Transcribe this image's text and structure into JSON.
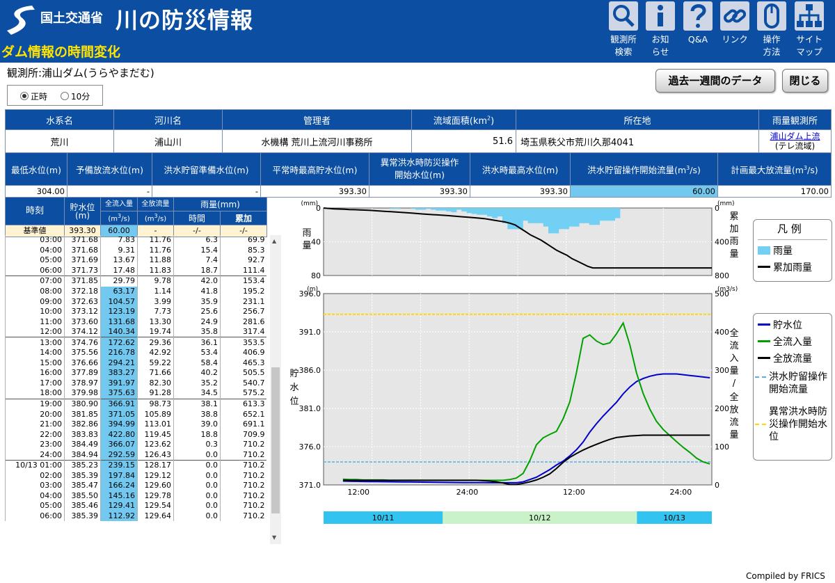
{
  "header": {
    "ministry": "国土交通省",
    "site_title": "川の防災情報",
    "page_heading": "ダム情報の時間変化",
    "nav": [
      {
        "label1": "観測所",
        "label2": "検索",
        "icon": "search-icon"
      },
      {
        "label1": "お知",
        "label2": "らせ",
        "icon": "info-icon"
      },
      {
        "label1": "Q&A",
        "label2": "",
        "icon": "question-icon"
      },
      {
        "label1": "リンク",
        "label2": "",
        "icon": "link-icon"
      },
      {
        "label1": "操作",
        "label2": "方法",
        "icon": "mouse-icon"
      },
      {
        "label1": "サイト",
        "label2": "マップ",
        "icon": "sitemap-icon"
      }
    ]
  },
  "station": {
    "label": "観測所:浦山ダム(うらやまだむ)"
  },
  "buttons": {
    "week": "過去一週間のデータ",
    "close": "閉じる"
  },
  "interval": {
    "options": [
      "正時",
      "10分"
    ],
    "selected": "正時"
  },
  "info1": {
    "headers": [
      "水系名",
      "河川名",
      "管理者",
      "流域面積(km",
      "2",
      ")",
      "所在地",
      "雨量観測所"
    ],
    "values": [
      "荒川",
      "浦山川",
      "水機構 荒川上流河川事務所",
      "51.6",
      "埼玉県秩父市荒川久那4041",
      "浦山ダム上流",
      "(テレ流域)"
    ]
  },
  "info2": {
    "headers": [
      "最低水位(m)",
      "予備放流水位(m)",
      "洪水貯留準備水位(m)",
      "平常時最高貯水位(m)",
      "異常洪水時防災操作",
      "開始水位(m)",
      "洪水時最高水位(m)",
      "洪水貯留操作開始流量(m",
      "3",
      "/s)",
      "計画最大放流量(m",
      "3",
      "/s)"
    ],
    "values": [
      "304.00",
      "-",
      "-",
      "393.30",
      "393.30",
      "393.30",
      "60.00",
      "170.00"
    ]
  },
  "data_table": {
    "headers": {
      "time": "時刻",
      "level": "貯水位",
      "level_unit": "(m)",
      "inflow": "全流入量",
      "inflow_unit": "(m",
      "outflow": "全放流量",
      "outflow_unit": "(m",
      "rain": "雨量(mm)",
      "hourly": "時間",
      "cumulative": "累加",
      "unit_sup": "3",
      "unit_tail": "/s)"
    },
    "base": {
      "label": "基準値",
      "level": "393.30",
      "inflow": "60.00",
      "outflow": "-",
      "hourly": "-/-",
      "cumulative": "-/-"
    },
    "rows": [
      [
        "03:00",
        "371.68",
        "7.83",
        "11.76",
        "6.3",
        "69.9"
      ],
      [
        "04:00",
        "371.68",
        "9.31",
        "11.76",
        "15.4",
        "85.3"
      ],
      [
        "05:00",
        "371.69",
        "13.67",
        "11.88",
        "7.4",
        "92.7"
      ],
      [
        "06:00",
        "371.73",
        "17.48",
        "11.83",
        "18.7",
        "111.4"
      ],
      [
        "07:00",
        "371.85",
        "29.79",
        "9.78",
        "42.0",
        "153.4"
      ],
      [
        "08:00",
        "372.18",
        "63.17",
        "1.14",
        "41.8",
        "195.2"
      ],
      [
        "09:00",
        "372.63",
        "104.57",
        "3.99",
        "35.9",
        "231.1"
      ],
      [
        "10:00",
        "373.12",
        "123.19",
        "7.73",
        "25.6",
        "256.7"
      ],
      [
        "11:00",
        "373.60",
        "131.68",
        "13.30",
        "24.9",
        "281.6"
      ],
      [
        "12:00",
        "374.12",
        "140.34",
        "19.74",
        "35.8",
        "317.4"
      ],
      [
        "13:00",
        "374.76",
        "172.62",
        "29.36",
        "36.1",
        "353.5"
      ],
      [
        "14:00",
        "375.56",
        "216.78",
        "42.92",
        "53.4",
        "406.9"
      ],
      [
        "15:00",
        "376.66",
        "294.21",
        "59.22",
        "58.4",
        "465.3"
      ],
      [
        "16:00",
        "377.89",
        "383.27",
        "71.66",
        "40.2",
        "505.5"
      ],
      [
        "17:00",
        "378.97",
        "391.97",
        "82.30",
        "35.2",
        "540.7"
      ],
      [
        "18:00",
        "379.98",
        "375.63",
        "91.28",
        "34.5",
        "575.2"
      ],
      [
        "19:00",
        "380.90",
        "366.91",
        "98.73",
        "38.1",
        "613.3"
      ],
      [
        "20:00",
        "381.85",
        "371.05",
        "105.89",
        "38.8",
        "652.1"
      ],
      [
        "21:00",
        "382.86",
        "394.99",
        "113.01",
        "39.0",
        "691.1"
      ],
      [
        "22:00",
        "383.83",
        "422.80",
        "119.45",
        "18.8",
        "709.9"
      ],
      [
        "23:00",
        "384.49",
        "366.07",
        "123.62",
        "0.3",
        "710.2"
      ],
      [
        "24:00",
        "384.94",
        "292.59",
        "126.43",
        "0.0",
        "710.2"
      ],
      [
        "10/13 01:00",
        "385.23",
        "239.15",
        "128.17",
        "0.0",
        "710.2"
      ],
      [
        "02:00",
        "385.39",
        "197.84",
        "129.12",
        "0.0",
        "710.2"
      ],
      [
        "03:00",
        "385.47",
        "166.24",
        "129.60",
        "0.0",
        "710.2"
      ],
      [
        "04:00",
        "385.50",
        "145.16",
        "129.78",
        "0.0",
        "710.2"
      ],
      [
        "05:00",
        "385.46",
        "129.41",
        "129.54",
        "0.0",
        "710.2"
      ],
      [
        "06:00",
        "385.39",
        "112.92",
        "129.64",
        "0.0",
        "710.2"
      ]
    ]
  },
  "chart_data": [
    {
      "type": "area",
      "ylabel": "雨量",
      "y2label": "累加雨量",
      "yunit": "(mm)",
      "y2unit": "(mm)",
      "ylim": [
        80,
        0
      ],
      "y2lim": [
        800,
        0
      ],
      "yticks": [
        "0",
        "40",
        "80"
      ],
      "y2ticks": [
        "0",
        "400",
        "800"
      ],
      "series": [
        {
          "name": "雨量"
        },
        {
          "name": "累加雨量"
        }
      ],
      "hourly_rain": [
        0,
        0,
        0,
        0,
        0,
        0,
        0,
        0,
        0,
        0,
        0,
        0,
        0,
        1,
        1,
        0,
        0,
        1,
        2,
        2,
        1,
        2,
        3,
        3,
        4,
        5,
        2,
        4,
        6,
        7,
        8,
        8,
        10,
        12,
        10,
        18,
        25,
        25,
        25,
        15,
        18,
        18,
        18,
        22,
        30,
        30,
        25,
        25,
        22,
        22,
        18,
        18,
        20,
        20,
        15,
        15,
        15,
        12,
        0,
        0,
        0,
        0,
        0,
        0,
        0,
        0,
        0,
        0,
        0,
        0,
        0,
        0,
        0,
        0,
        0,
        0
      ],
      "cumulative_rain": [
        0,
        5,
        10,
        12,
        15,
        18,
        20,
        22,
        25,
        28,
        32,
        36,
        40,
        44,
        48,
        52,
        56,
        60,
        65,
        70,
        74,
        78,
        82,
        86,
        90,
        95,
        100,
        105,
        110,
        115,
        120,
        125,
        135,
        145,
        155,
        165,
        180,
        200,
        240,
        280,
        320,
        350,
        380,
        420,
        460,
        500,
        530,
        560,
        600,
        630,
        660,
        690,
        710,
        710,
        710,
        710,
        710,
        710,
        710,
        710,
        710,
        710,
        710,
        710,
        710,
        710,
        710,
        710,
        710,
        710,
        710,
        710,
        710,
        710,
        710,
        710
      ]
    },
    {
      "type": "line",
      "ylabel": "貯水位",
      "y2label": "全流入量/全放流量",
      "yunit": "(m)",
      "y2unit": "(m3/s)",
      "ylim": [
        371.0,
        396.0
      ],
      "y2lim": [
        0,
        500
      ],
      "yticks": [
        "371.0",
        "376.0",
        "381.0",
        "386.0",
        "391.0",
        "396.0"
      ],
      "y2ticks": [
        "0",
        "100",
        "200",
        "300",
        "400",
        "500"
      ],
      "x_ticks": [
        "12:00",
        "24:00",
        "12:00",
        "24:00"
      ],
      "date_bands": [
        "10/11",
        "10/12",
        "10/13"
      ],
      "series": [
        {
          "name": "貯水位",
          "color": "#0000cc"
        },
        {
          "name": "全流入量",
          "color": "#00a000"
        },
        {
          "name": "全放流量",
          "color": "#000000"
        },
        {
          "name": "洪水貯留操作開始流量",
          "color": "#58b0e8",
          "value": 60.0
        },
        {
          "name": "異常洪水時防災操作開始水位",
          "color": "#ffd800",
          "value": 393.3
        }
      ],
      "level": [
        371.5,
        371.48,
        371.46,
        371.45,
        371.44,
        371.43,
        371.42,
        371.41,
        371.4,
        371.39,
        371.38,
        371.37,
        371.36,
        371.35,
        371.34,
        371.33,
        371.32,
        371.31,
        371.3,
        371.3,
        371.29,
        371.29,
        371.28,
        371.28,
        371.28,
        371.28,
        371.28,
        371.4,
        371.7,
        372.0,
        372.5,
        373.0,
        373.6,
        374.1,
        374.8,
        375.6,
        376.6,
        377.9,
        379.0,
        380.0,
        380.9,
        381.8,
        382.9,
        383.8,
        384.5,
        384.9,
        385.2,
        385.4,
        385.5,
        385.5,
        385.5,
        385.4,
        385.3,
        385.2,
        385.1,
        385.0
      ],
      "inflow": [
        15,
        14,
        14,
        13,
        13,
        13,
        13,
        12,
        12,
        12,
        12,
        12,
        12,
        12,
        12,
        12,
        12,
        12,
        12,
        12,
        12,
        12,
        12,
        12,
        12,
        14,
        18,
        30,
        63,
        105,
        123,
        132,
        140,
        173,
        217,
        294,
        383,
        392,
        376,
        367,
        371,
        395,
        423,
        366,
        293,
        239,
        198,
        166,
        145,
        129,
        113,
        98,
        85,
        70,
        60,
        55
      ],
      "outflow": [
        12,
        12,
        12,
        12,
        12,
        12,
        12,
        12,
        12,
        12,
        12,
        12,
        12,
        12,
        12,
        12,
        12,
        12,
        12,
        12,
        12,
        11,
        10,
        8,
        5,
        1,
        1,
        4,
        8,
        13,
        20,
        29,
        43,
        59,
        72,
        82,
        91,
        99,
        106,
        113,
        119,
        124,
        126,
        128,
        129,
        130,
        130,
        130,
        130,
        130,
        130,
        130,
        130,
        130,
        130,
        130
      ]
    }
  ],
  "credit": "Compiled by FRICS"
}
